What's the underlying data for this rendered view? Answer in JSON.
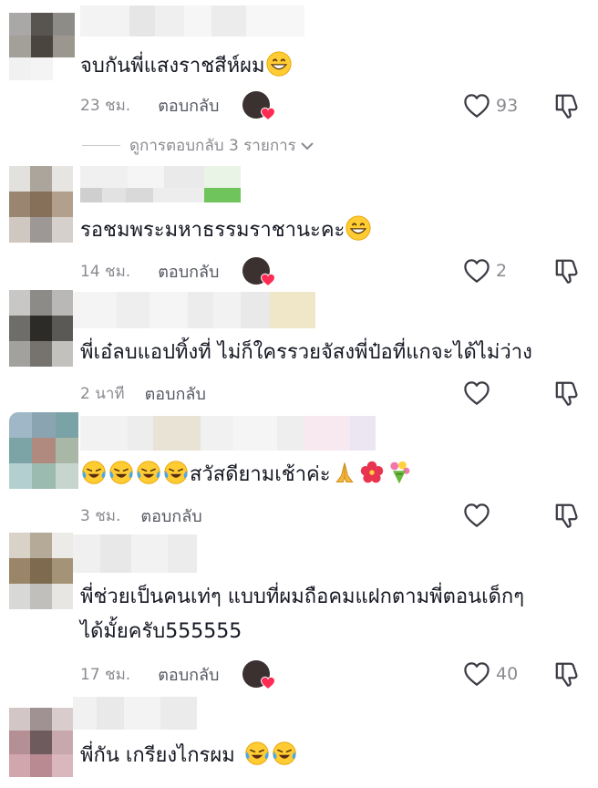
{
  "comments": [
    {
      "text": "จบกันพี่แสงราชสีห์ผม",
      "emojis": [
        "grinning-face-emoji"
      ],
      "time": "23 ชม.",
      "reply_label": "ตอบกลับ",
      "creator_liked": true,
      "likes": "93"
    },
    {
      "text": "รอชมพระมหาธรรมราชานะคะ",
      "emojis": [
        "grinning-face-emoji"
      ],
      "time": "14 ชม.",
      "reply_label": "ตอบกลับ",
      "creator_liked": true,
      "likes": "2"
    },
    {
      "text": "พี่เอ๋ลบแอปทิ้งที่ ไม่ก็ใครรวยจัสงพี่ป๋อที่แกจะได้ไม่ว่าง",
      "time": "2 นาที",
      "reply_label": "ตอบกลับ",
      "creator_liked": false,
      "likes": ""
    },
    {
      "text": "สวัสดียามเช้าค่ะ",
      "emojis_before": [
        "tears-of-joy-emoji",
        "tears-of-joy-emoji",
        "tears-of-joy-emoji",
        "tears-of-joy-emoji"
      ],
      "emojis_after": [
        "folded-hands-emoji",
        "hibiscus-emoji",
        "bouquet-emoji"
      ],
      "time": "3 ชม.",
      "reply_label": "ตอบกลับ",
      "creator_liked": false,
      "likes": ""
    },
    {
      "text_line1": "พี่ช่วยเป็นคนเท่ๆ แบบที่ผมถือคมแฝกตามพี่ตอนเด็กๆ",
      "text_line2": "ได้มั้ยครับ555555",
      "time": "17 ชม.",
      "reply_label": "ตอบกลับ",
      "creator_liked": true,
      "likes": "40"
    },
    {
      "text": "พี่กัน เกรียงไกรผม",
      "emojis": [
        "tears-of-joy-emoji",
        "tears-of-joy-emoji"
      ]
    }
  ],
  "view_replies": "ดูการตอบกลับ 3 รายการ",
  "icons": {
    "like": "heart-outline-icon",
    "dislike": "thumbs-down-icon",
    "expand": "chevron-down-icon",
    "creator_heart": "red-heart-icon"
  },
  "colors": {
    "text": "#161823",
    "muted": "#8a8b91",
    "heart_badge": "#fe2c55"
  }
}
